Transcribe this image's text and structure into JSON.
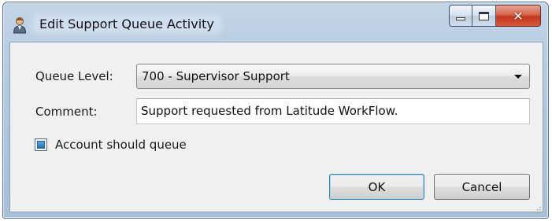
{
  "window": {
    "title": "Edit Support Queue Activity",
    "icon": "user-icon",
    "controls": {
      "minimize": "minimize-icon",
      "maximize": "maximize-icon",
      "close": "close-icon"
    }
  },
  "form": {
    "queue_level": {
      "label": "Queue Level:",
      "value": "700 - Supervisor Support"
    },
    "comment": {
      "label": "Comment:",
      "value": "Support requested from Latitude WorkFlow."
    },
    "account_should_queue": {
      "label": "Account should queue",
      "checked": true
    }
  },
  "buttons": {
    "ok": "OK",
    "cancel": "Cancel"
  },
  "colors": {
    "titlebar": "#b2c8df",
    "close_button": "#c2371d",
    "checkbox_fill": "#1e73b7",
    "client_bg": "#f0f0f0"
  }
}
